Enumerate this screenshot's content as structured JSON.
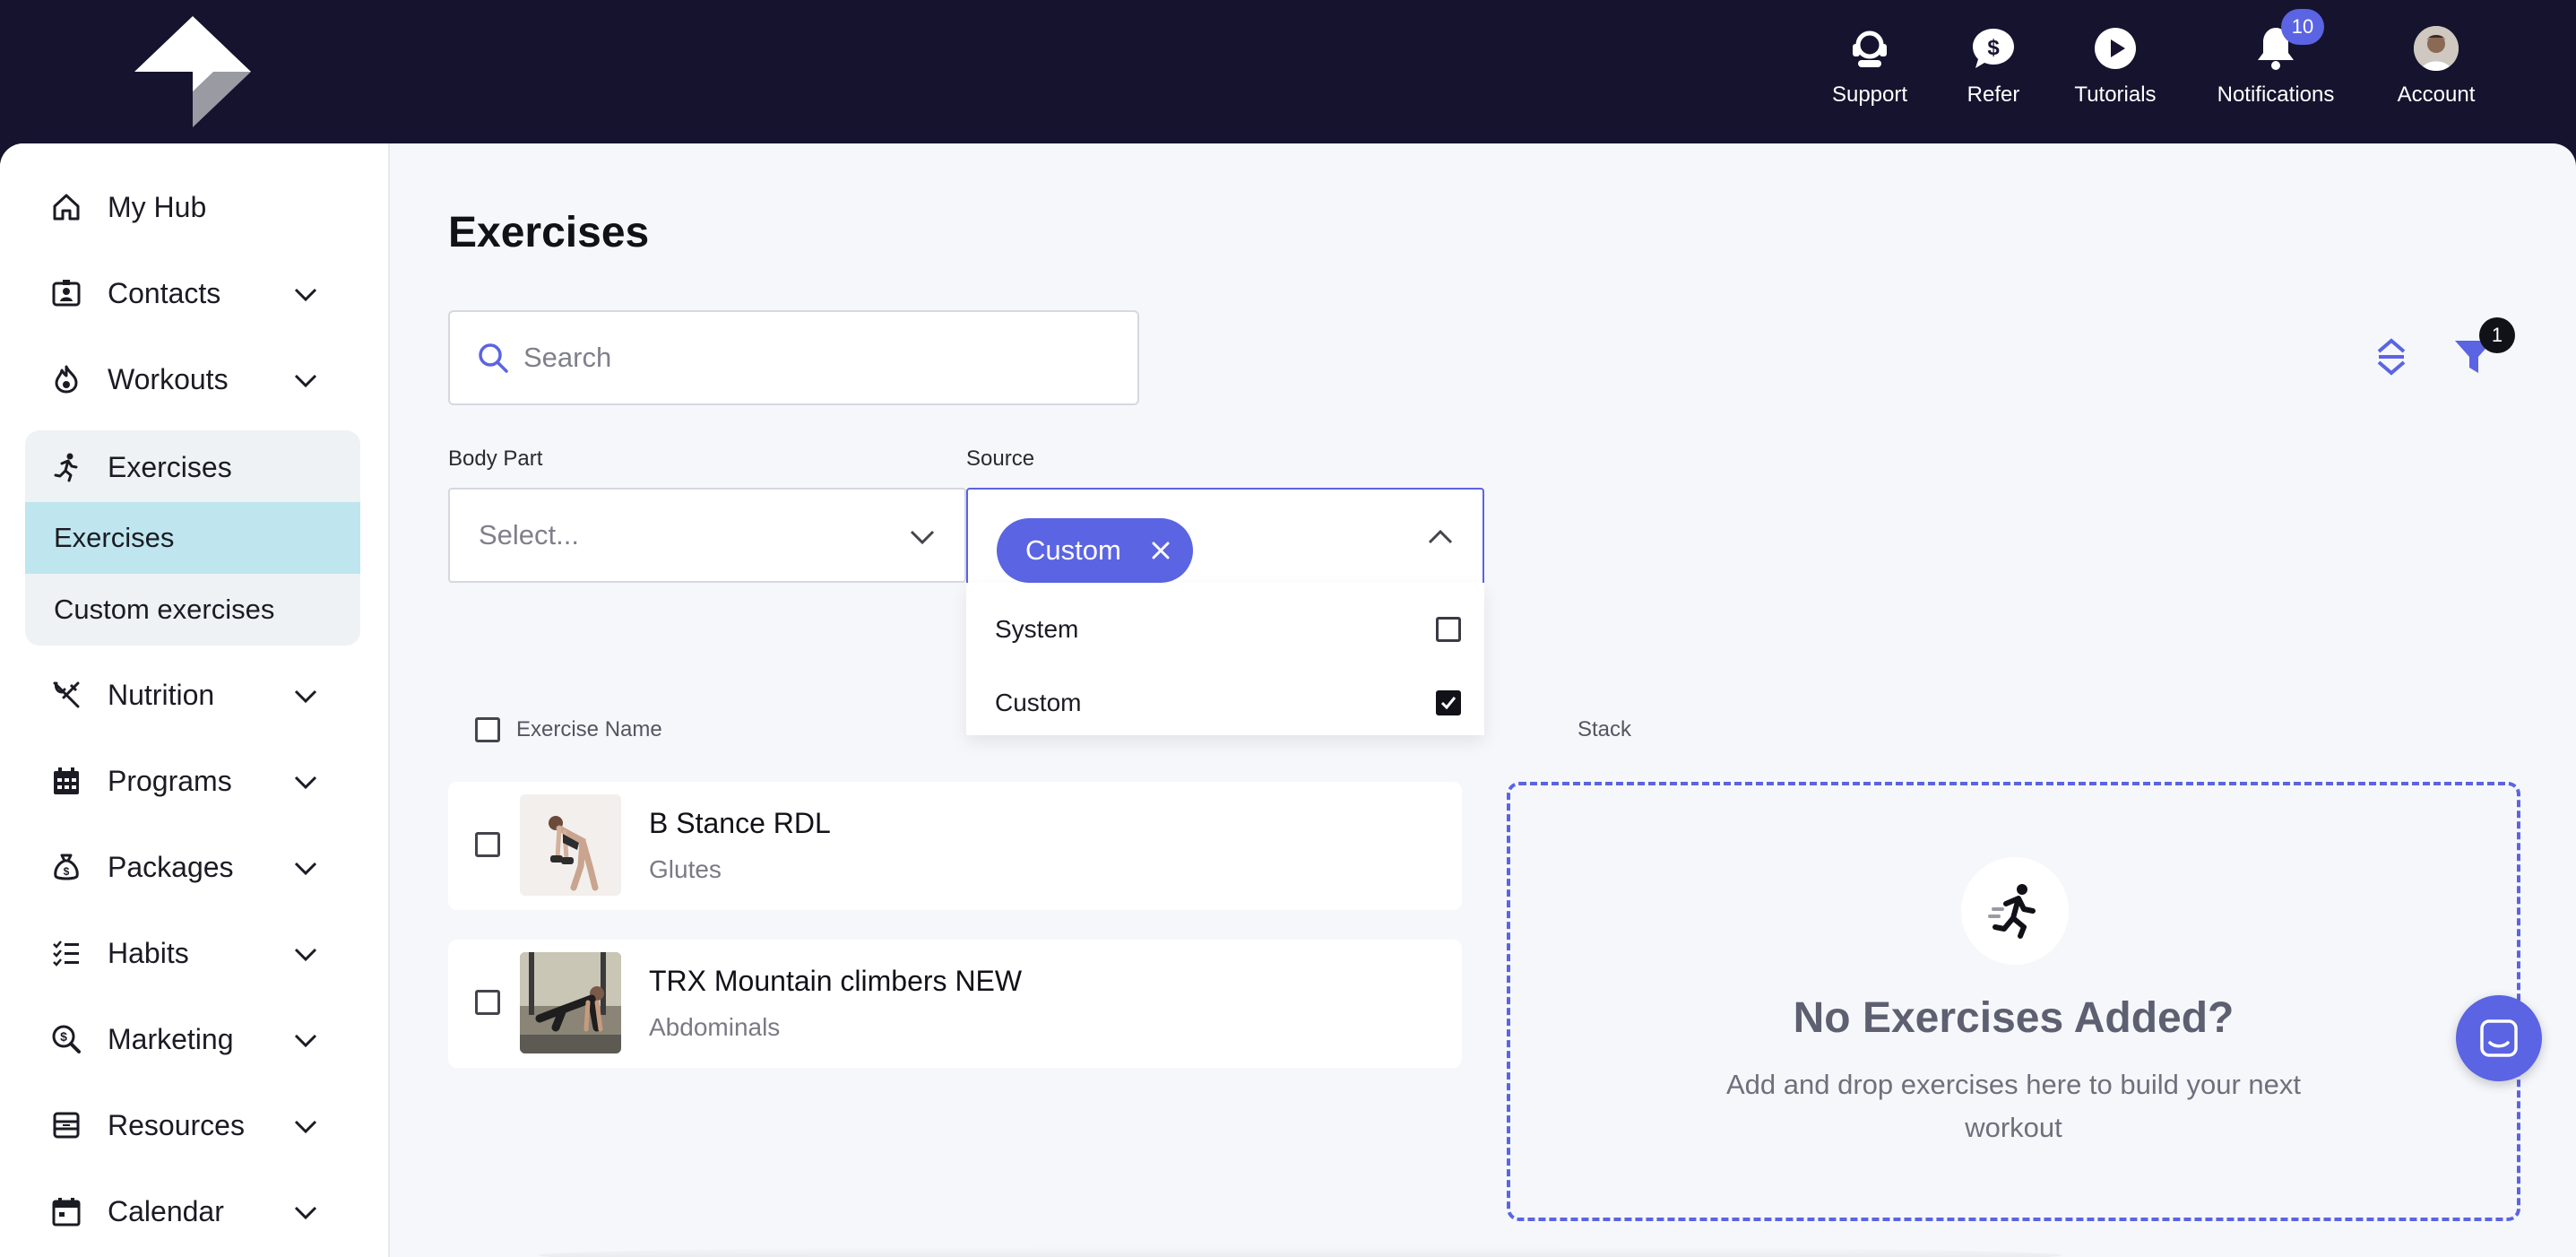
{
  "topbar": {
    "items": [
      {
        "label": "Support",
        "icon": "headset-icon"
      },
      {
        "label": "Refer",
        "icon": "dollar-bubble-icon"
      },
      {
        "label": "Tutorials",
        "icon": "play-circle-icon"
      },
      {
        "label": "Notifications",
        "icon": "bell-icon",
        "badge": "10"
      },
      {
        "label": "Account",
        "icon": "avatar"
      }
    ]
  },
  "sidebar": {
    "items": [
      {
        "label": "My Hub",
        "icon": "home-icon"
      },
      {
        "label": "Contacts",
        "icon": "contact-card-icon"
      },
      {
        "label": "Workouts",
        "icon": "flame-icon"
      },
      {
        "label": "Exercises",
        "icon": "runner-icon"
      },
      {
        "label": "Nutrition",
        "icon": "fork-knife-icon"
      },
      {
        "label": "Programs",
        "icon": "calendar-grid-icon"
      },
      {
        "label": "Packages",
        "icon": "money-bag-icon"
      },
      {
        "label": "Habits",
        "icon": "checklist-icon"
      },
      {
        "label": "Marketing",
        "icon": "search-dollar-icon"
      },
      {
        "label": "Resources",
        "icon": "archive-icon"
      },
      {
        "label": "Calendar",
        "icon": "calendar-icon"
      }
    ],
    "exercises_sub": [
      {
        "label": "Exercises",
        "active": true
      },
      {
        "label": "Custom exercises",
        "active": false
      }
    ]
  },
  "main": {
    "title": "Exercises",
    "search_placeholder": "Search",
    "body_part": {
      "label": "Body Part",
      "placeholder": "Select..."
    },
    "source": {
      "label": "Source",
      "selected_chip": "Custom",
      "options": [
        {
          "label": "System",
          "checked": false
        },
        {
          "label": "Custom",
          "checked": true
        }
      ]
    },
    "filter_count": "1",
    "columns": {
      "name": "Exercise Name",
      "stack": "Stack"
    },
    "rows": [
      {
        "name": "B Stance RDL",
        "body_part": "Glutes"
      },
      {
        "name": "TRX Mountain climbers NEW",
        "body_part": "Abdominals"
      }
    ],
    "stack": {
      "title": "No Exercises Added?",
      "description": "Add and drop exercises here to build your next workout"
    }
  },
  "colors": {
    "accent": "#5b64e3",
    "topbar": "#16132f",
    "active_sub": "#bfe6ef"
  }
}
